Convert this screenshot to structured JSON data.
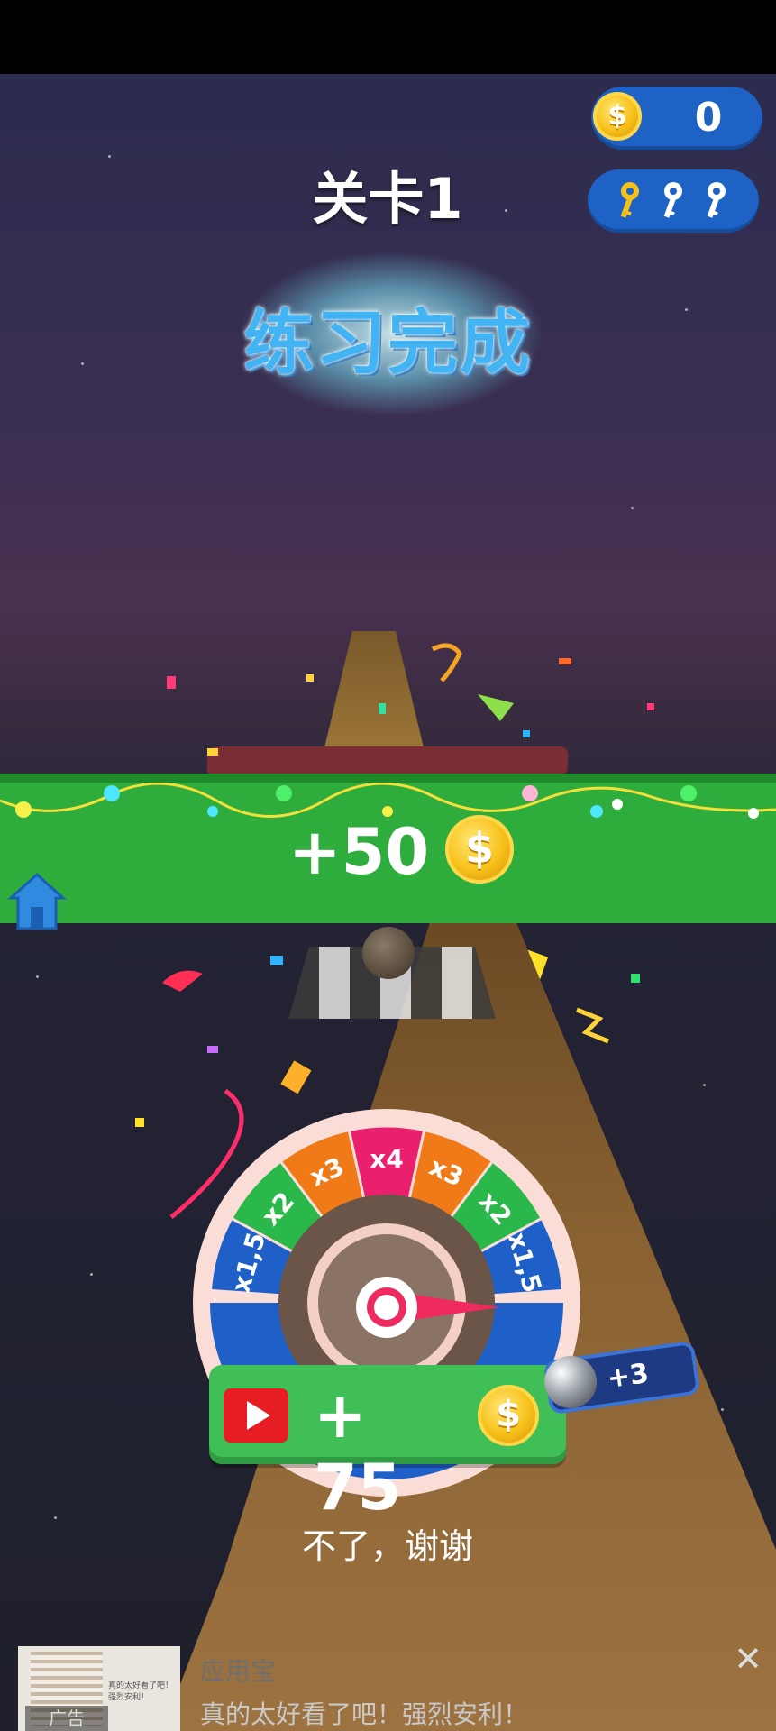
{
  "hud": {
    "coins": "0",
    "keys_count_shown": 3,
    "keys_collected": 1
  },
  "level": {
    "title": "关卡1",
    "status_text": "练习完成"
  },
  "reward": {
    "amount_text": "+50"
  },
  "wheel": {
    "segments": [
      "x1,5",
      "x2",
      "x3",
      "x4",
      "x3",
      "x2",
      "x1,5"
    ],
    "colors": [
      "#1f5fc8",
      "#2ab84a",
      "#f07a17",
      "#ea1f6d",
      "#f07a17",
      "#2ab84a",
      "#1f5fc8"
    ]
  },
  "spin_button": {
    "label": "+ 75"
  },
  "ball_bonus": {
    "label": "+3"
  },
  "no_thanks": {
    "label": "不了，谢谢"
  },
  "ad": {
    "badge": "广告",
    "app_name": "应用宝",
    "description": "真的太好看了吧！强烈安利！",
    "thumb_text": "真的太好看了吧！强烈安利！"
  },
  "colors": {
    "banner_green": "#2fad3c",
    "pill_blue": "#1d62c4",
    "coin_gold": "#f7c11a",
    "glow_text": "#42b4f4"
  }
}
